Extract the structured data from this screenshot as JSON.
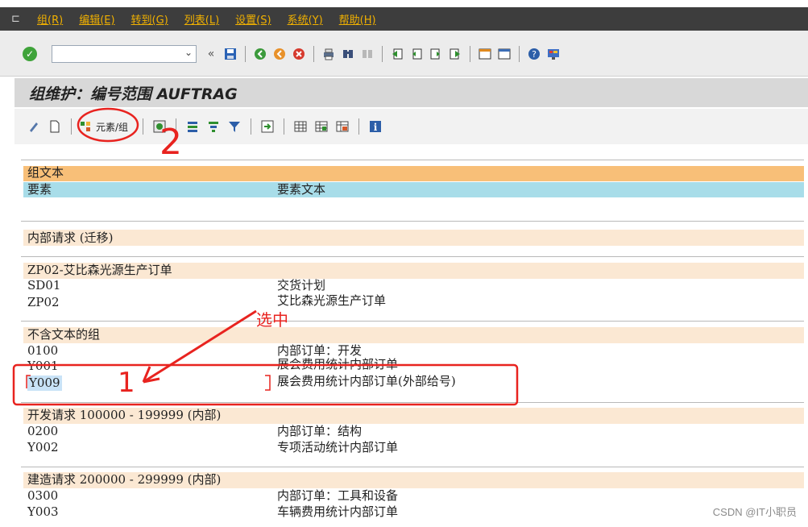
{
  "menu": [
    "组(R)",
    "编辑(E)",
    "转到(G)",
    "列表(L)",
    "设置(S)",
    "系统(Y)",
    "帮助(H)"
  ],
  "command_field": {
    "value": ""
  },
  "title": "组维护：编号范围 AUFTRAG",
  "app_toolbar": {
    "element_group_label": "元素/组"
  },
  "header": {
    "group_text": "组文本",
    "element": "要素",
    "element_text": "要素文本"
  },
  "groups": [
    {
      "title": "内部请求 (迁移)",
      "rows": []
    },
    {
      "title": "ZP02-艾比森光源生产订单",
      "rows": [
        {
          "code": "SD01",
          "text": "交货计划"
        },
        {
          "code": "ZP02",
          "text": "艾比森光源生产订单"
        }
      ]
    },
    {
      "title": "不含文本的组",
      "rows": [
        {
          "code": "0100",
          "text": "内部订单：开发"
        },
        {
          "code": "Y001",
          "text": "展会费用统计内部订单"
        },
        {
          "code": "Y009",
          "text": "展会费用统计内部订单(外部给号)"
        }
      ]
    },
    {
      "title": "开发请求 100000 - 199999 (内部)",
      "rows": [
        {
          "code": "0200",
          "text": "内部订单：结构"
        },
        {
          "code": "Y002",
          "text": "专项活动统计内部订单"
        }
      ]
    },
    {
      "title": "建造请求 200000 - 299999 (内部)",
      "rows": [
        {
          "code": "0300",
          "text": "内部订单：工具和设备"
        },
        {
          "code": "Y003",
          "text": "车辆费用统计内部订单"
        }
      ]
    }
  ],
  "annotations": {
    "select_label": "选中",
    "step1": "1",
    "step2": "2",
    "color": "#e8231f"
  },
  "watermark": "CSDN @IT小职员"
}
